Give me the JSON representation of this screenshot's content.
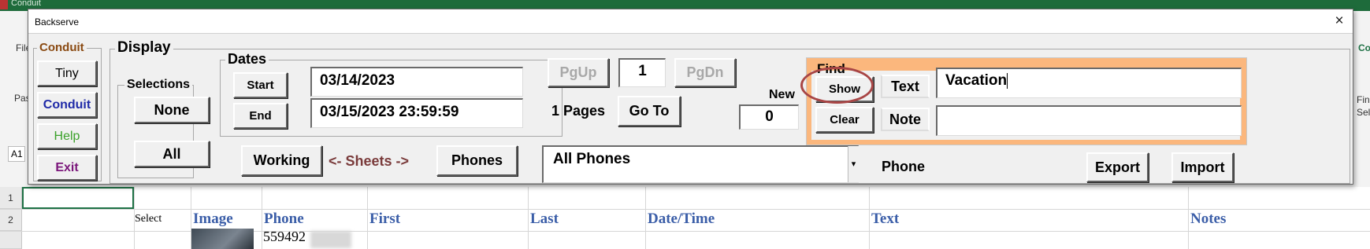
{
  "background": {
    "window_title": "Conduit",
    "file_tab": "File",
    "paste_label": "Pas",
    "namebox": "A1",
    "right_tab": "Co",
    "right_label_1": "Fin",
    "right_label_2": "Sele",
    "row_headers": [
      "1",
      "2"
    ],
    "columns": {
      "select": "Select",
      "image": "Image",
      "phone": "Phone",
      "first": "First",
      "last": "Last",
      "datetime": "Date/Time",
      "text": "Text",
      "notes": "Notes"
    },
    "row3_phone": "559492"
  },
  "dialog": {
    "title": "Backserve",
    "close_label": "×",
    "conduit_group": {
      "title": "Conduit",
      "buttons": [
        "Tiny",
        "Conduit",
        "Help",
        "Exit"
      ],
      "colors": [
        "#000000",
        "#1f2aa8",
        "#3aa12a",
        "#7a157a"
      ]
    },
    "display_group": {
      "title": "Display"
    },
    "selections_group": {
      "title": "Selections",
      "none_label": "None",
      "all_label": "All"
    },
    "dates_group": {
      "title": "Dates",
      "start_label": "Start",
      "end_label": "End",
      "start_value": "03/14/2023",
      "end_value": "03/15/2023 23:59:59"
    },
    "paging": {
      "pgup_label": "PgUp",
      "page_value": "1",
      "pgdn_label": "PgDn",
      "pages_text": "1 Pages",
      "goto_label": "Go To"
    },
    "new": {
      "label": "New",
      "value": "0"
    },
    "sheets": {
      "working_label": "Working",
      "arrow_text": "<- Sheets ->",
      "phones_label": "Phones",
      "arrow_color": "#7a3b3b"
    },
    "phones_select": {
      "value": "All Phones",
      "arrow": "▾"
    },
    "phone_label": "Phone",
    "export_label": "Export",
    "import_label": "Import",
    "find": {
      "title": "Find",
      "show_label": "Show",
      "clear_label": "Clear",
      "text_label": "Text",
      "note_label": "Note",
      "text_value": "Vacation",
      "note_value": "",
      "panel_color": "#fbb77d",
      "highlight_color": "#a84545"
    }
  }
}
